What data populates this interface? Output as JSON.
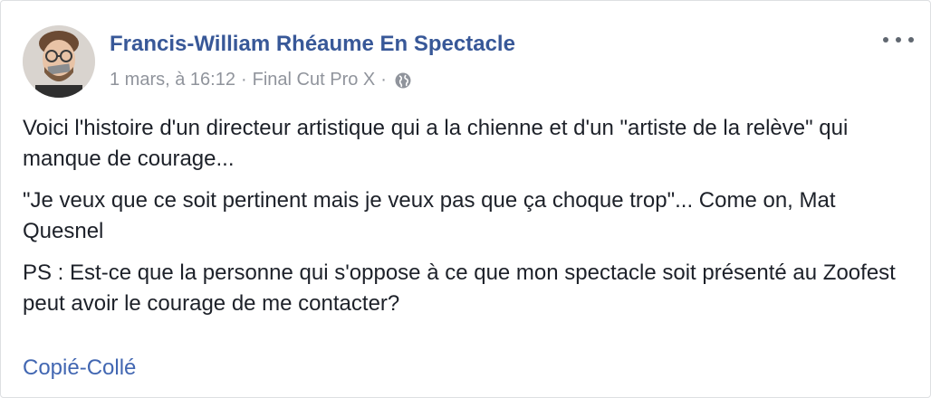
{
  "post": {
    "author": "Francis-William Rhéaume En Spectacle",
    "date": "1 mars, à 16:12",
    "separator": "·",
    "app": "Final Cut Pro X",
    "privacy_icon": "globe-icon",
    "paragraphs": [
      "Voici l'histoire d'un directeur artistique qui a la chienne et d'un \"artiste de la relève\" qui manque de courage...",
      "\"Je veux que ce soit pertinent mais je veux pas que ça choque trop\"... Come on, Mat Quesnel",
      "PS : Est-ce que la personne qui s'oppose à ce que mon spectacle soit présenté au Zoofest peut avoir le courage de me contacter?"
    ],
    "link_text": "Copié-Collé",
    "more_icon": "more-options-icon"
  },
  "colors": {
    "author": "#385898",
    "meta": "#90949c",
    "text": "#1d2129",
    "link": "#4267b2"
  }
}
